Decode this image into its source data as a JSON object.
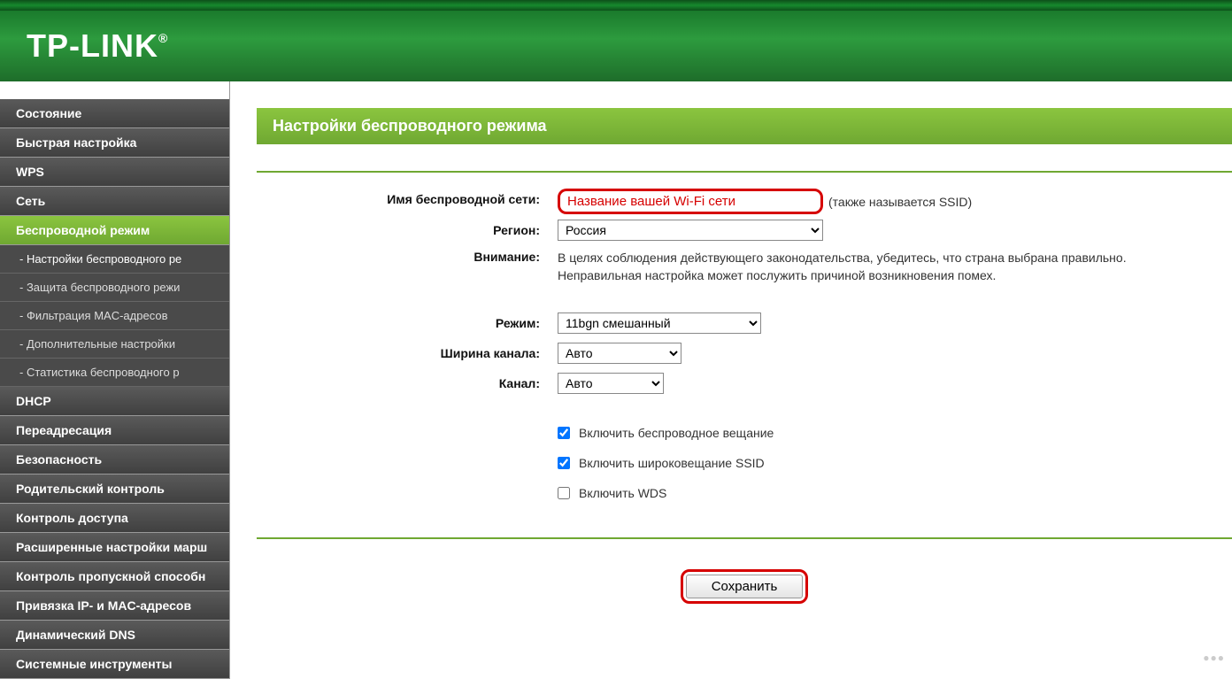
{
  "brand": "TP-LINK",
  "brand_mark": "®",
  "sidebar": {
    "items": [
      {
        "label": "Состояние",
        "type": "main"
      },
      {
        "label": "Быстрая настройка",
        "type": "main"
      },
      {
        "label": "WPS",
        "type": "main"
      },
      {
        "label": "Сеть",
        "type": "main"
      },
      {
        "label": "Беспроводной режим",
        "type": "main",
        "active": true
      },
      {
        "label": "- Настройки беспроводного ре",
        "type": "sub",
        "active": true
      },
      {
        "label": "- Защита беспроводного режи",
        "type": "sub"
      },
      {
        "label": "- Фильтрация MAC-адресов",
        "type": "sub"
      },
      {
        "label": "- Дополнительные настройки",
        "type": "sub"
      },
      {
        "label": "- Статистика беспроводного р",
        "type": "sub"
      },
      {
        "label": "DHCP",
        "type": "main"
      },
      {
        "label": "Переадресация",
        "type": "main"
      },
      {
        "label": "Безопасность",
        "type": "main"
      },
      {
        "label": "Родительский контроль",
        "type": "main"
      },
      {
        "label": "Контроль доступа",
        "type": "main"
      },
      {
        "label": "Расширенные настройки марш",
        "type": "main"
      },
      {
        "label": "Контроль пропускной способн",
        "type": "main"
      },
      {
        "label": "Привязка IP- и MAC-адресов",
        "type": "main"
      },
      {
        "label": "Динамический DNS",
        "type": "main"
      },
      {
        "label": "Системные инструменты",
        "type": "main"
      }
    ]
  },
  "panel": {
    "title": "Настройки беспроводного режима",
    "ssid_label": "Имя беспроводной сети:",
    "ssid_value": "Название вашей Wi-Fi сети",
    "ssid_hint": "(также называется SSID)",
    "region_label": "Регион:",
    "region_value": "Россия",
    "warning_label": "Внимание:",
    "warning_text": "В целях соблюдения действующего законодательства, убедитесь, что страна выбрана правильно. Неправильная настройка может послужить причиной возникновения помех.",
    "mode_label": "Режим:",
    "mode_value": "11bgn смешанный",
    "width_label": "Ширина канала:",
    "width_value": "Авто",
    "channel_label": "Канал:",
    "channel_value": "Авто",
    "cb_broadcast": "Включить беспроводное вещание",
    "cb_ssid": "Включить широковещание SSID",
    "cb_wds": "Включить WDS",
    "save": "Сохранить"
  }
}
